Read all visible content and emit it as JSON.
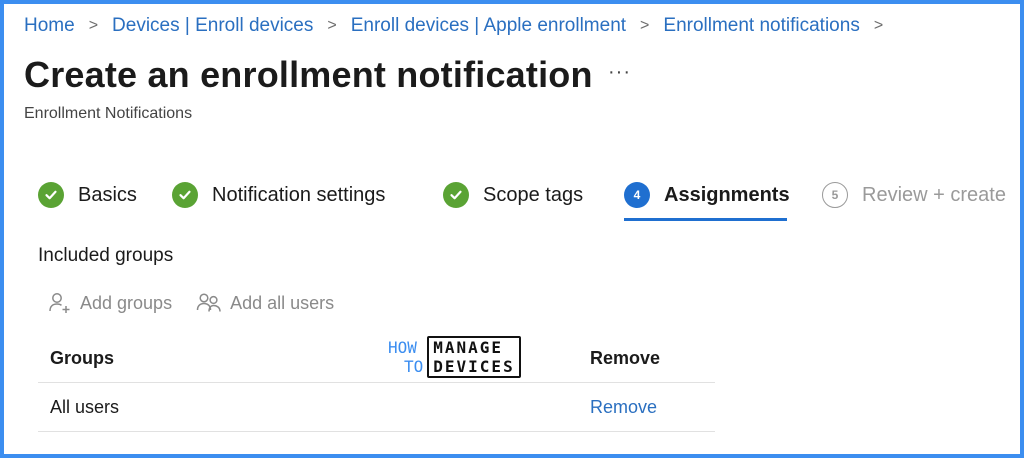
{
  "breadcrumb": {
    "items": [
      "Home",
      "Devices | Enroll devices",
      "Enroll devices | Apple enrollment",
      "Enrollment notifications"
    ],
    "separator": ">"
  },
  "header": {
    "title": "Create an enrollment notification",
    "more": "···",
    "subtitle": "Enrollment Notifications"
  },
  "wizard": {
    "steps": [
      {
        "label": "Basics",
        "state": "done"
      },
      {
        "label": "Notification settings",
        "state": "done"
      },
      {
        "label": "Scope tags",
        "state": "done"
      },
      {
        "number": "4",
        "label": "Assignments",
        "state": "active"
      },
      {
        "number": "5",
        "label": "Review + create",
        "state": "disabled"
      }
    ]
  },
  "included": {
    "title": "Included groups",
    "add_groups": "Add groups",
    "add_all_users": "Add all users"
  },
  "table": {
    "columns": [
      "Groups",
      "Remove"
    ],
    "rows": [
      {
        "group": "All users",
        "action": "Remove"
      }
    ]
  },
  "watermark": {
    "left": [
      "HOW",
      "TO"
    ],
    "right": [
      "MANAGE",
      "DEVICES"
    ]
  },
  "colors": {
    "accent": "#1f6fd0",
    "link": "#2a6fc0",
    "success": "#5aa334",
    "frame": "#3c8ef0",
    "disabled": "#9a9a9a"
  }
}
